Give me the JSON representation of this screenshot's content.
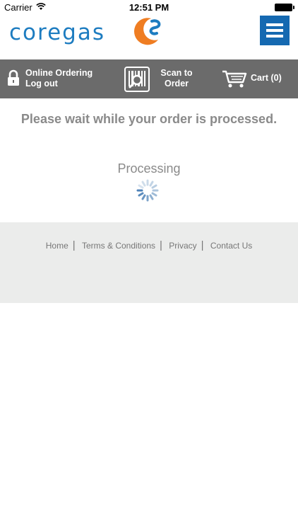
{
  "status_bar": {
    "carrier": "Carrier",
    "time": "12:51 PM"
  },
  "header": {
    "logo_text": "coregas",
    "brand_colors": {
      "blue": "#1d7cc0",
      "orange": "#ef7d22",
      "menu": "#1569b1"
    }
  },
  "navbar": {
    "account_title": "Online Ordering",
    "logout_label": "Log out",
    "scan_label_line1": "Scan to",
    "scan_label_line2": "Order",
    "cart_label": "Cart (0)",
    "icons": [
      "lock-icon",
      "barcode-scan-icon",
      "cart-icon"
    ]
  },
  "main": {
    "message": "Please wait while your order is processed.",
    "processing_label": "Processing"
  },
  "footer": {
    "links": [
      "Home",
      "Terms & Conditions",
      "Privacy",
      "Contact Us"
    ]
  }
}
